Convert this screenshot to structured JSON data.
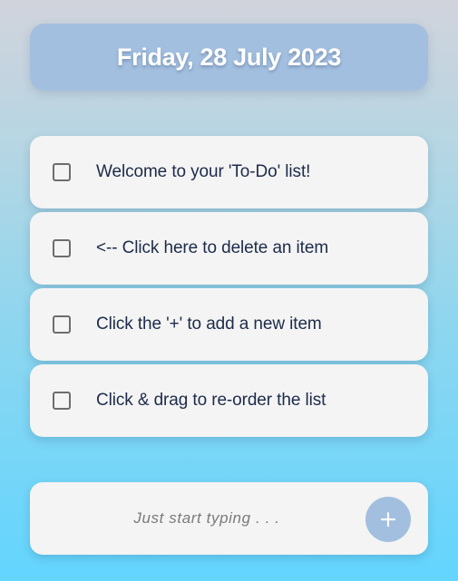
{
  "header": {
    "date": "Friday, 28 July 2023"
  },
  "todos": [
    {
      "label": "Welcome to your 'To-Do' list!",
      "checked": false
    },
    {
      "label": "<-- Click here to delete an item",
      "checked": false
    },
    {
      "label": "Click the '+' to add a new item",
      "checked": false
    },
    {
      "label": "Click & drag to re-order the list",
      "checked": false
    }
  ],
  "new_item": {
    "placeholder": "Just start typing . . .",
    "value": "",
    "add_label": "+"
  },
  "colors": {
    "accent": "#a3bfdf",
    "card": "#f4f4f4",
    "text": "#1d2b4a",
    "background_top": "#d1d3dc",
    "background_bottom": "#63d5fe"
  }
}
